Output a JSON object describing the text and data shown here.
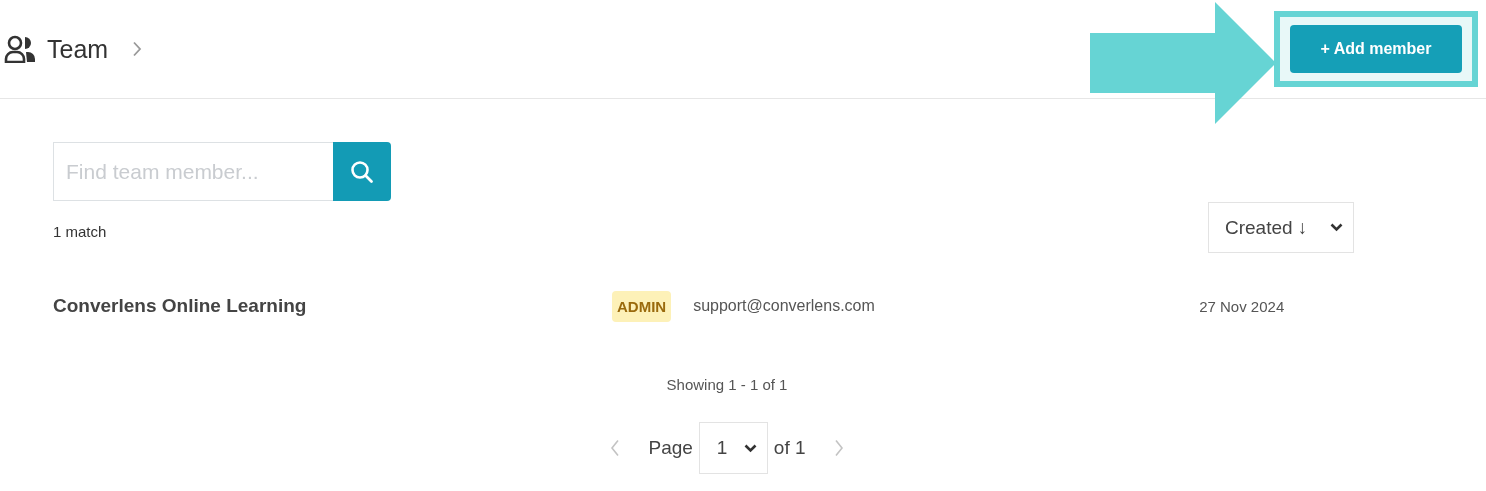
{
  "header": {
    "title": "Team",
    "add_button": "+ Add member"
  },
  "search": {
    "placeholder": "Find team member..."
  },
  "match_count": "1 match",
  "sort": {
    "label": "Created ↓"
  },
  "members": [
    {
      "name": "Converlens Online Learning",
      "role": "ADMIN",
      "email": "support@converlens.com",
      "created": "27 Nov 2024"
    }
  ],
  "showing": "Showing 1 - 1 of 1",
  "pagination": {
    "page_label": "Page",
    "page": "1",
    "of_label": "of 1",
    "prev_disabled": true,
    "next_disabled": true
  }
}
